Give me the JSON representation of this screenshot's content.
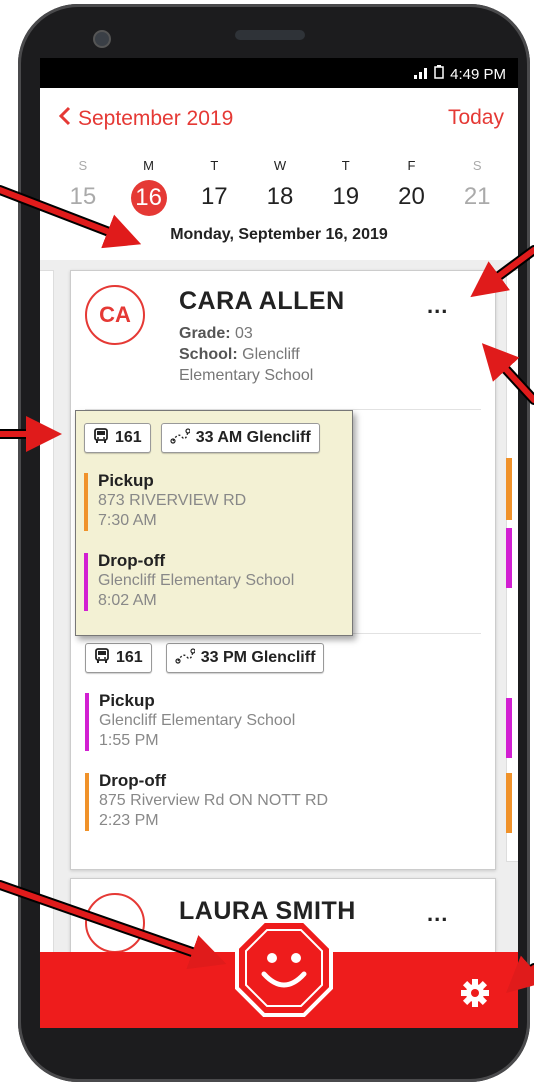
{
  "status_bar": {
    "time": "4:49 PM"
  },
  "calendar": {
    "month_label": "September 2019",
    "today_label": "Today",
    "days": [
      {
        "dow": "S",
        "num": "15"
      },
      {
        "dow": "M",
        "num": "16"
      },
      {
        "dow": "T",
        "num": "17"
      },
      {
        "dow": "W",
        "num": "18"
      },
      {
        "dow": "T",
        "num": "19"
      },
      {
        "dow": "F",
        "num": "20"
      },
      {
        "dow": "S",
        "num": "21"
      }
    ],
    "selected_date": "Monday, September 16, 2019"
  },
  "students": [
    {
      "initials": "CA",
      "name": "CARA ALLEN",
      "grade_label": "Grade:",
      "grade": "03",
      "school_label": "School:",
      "school_line1": "Glencliff",
      "school_line2": "Elementary School",
      "menu": "...",
      "trips": [
        {
          "bus": "161",
          "route": "33 AM Glencliff",
          "stops": [
            {
              "type": "Pickup",
              "place": "873 RIVERVIEW RD",
              "time": "7:30 AM",
              "color": "#f0922a"
            },
            {
              "type": "Drop-off",
              "place": "Glencliff Elementary School",
              "time": "8:02 AM",
              "color": "#d21fd2"
            }
          ]
        },
        {
          "bus": "161",
          "route": "33 PM Glencliff",
          "stops": [
            {
              "type": "Pickup",
              "place": "Glencliff Elementary School",
              "time": "1:55 PM",
              "color": "#d21fd2"
            },
            {
              "type": "Drop-off",
              "place": "875 Riverview Rd ON NOTT RD",
              "time": "2:23 PM",
              "color": "#f0922a"
            }
          ]
        }
      ]
    },
    {
      "name": "LAURA SMITH",
      "menu": "..."
    }
  ],
  "colors": {
    "accent": "#e53935",
    "bottom_bar": "#ee1c1c",
    "highlight": "#f3f1d4",
    "annotation_arrow": "#e01b1b"
  },
  "icons": {
    "bus": "bus-icon",
    "route": "route-icon",
    "stop": "stop-sign-icon",
    "settings": "gear-icon"
  }
}
